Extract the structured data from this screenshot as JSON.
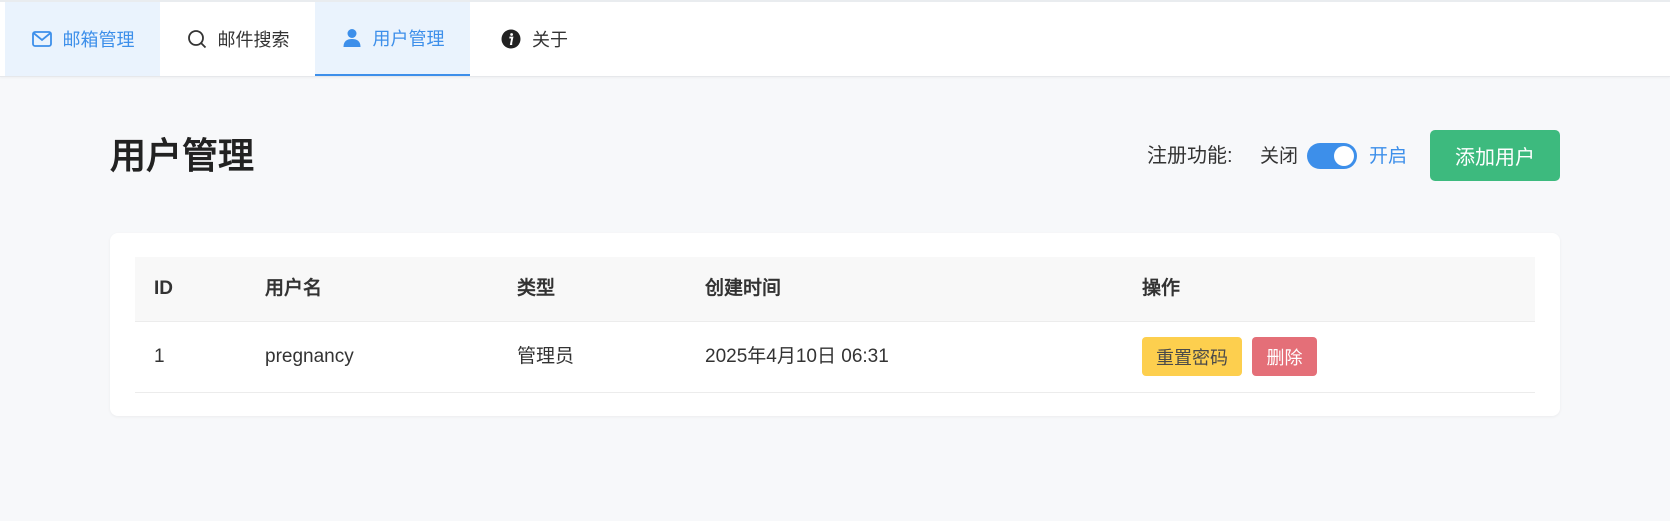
{
  "nav": {
    "tabs": [
      {
        "label": "邮箱管理",
        "icon": "mail-icon",
        "active": false
      },
      {
        "label": "邮件搜索",
        "icon": "search-icon",
        "active": false
      },
      {
        "label": "用户管理",
        "icon": "user-icon",
        "active": true
      },
      {
        "label": "关于",
        "icon": "info-icon",
        "active": false
      }
    ]
  },
  "header": {
    "title": "用户管理",
    "registration": {
      "label": "注册功能:",
      "off_label": "关闭",
      "on_label": "开启",
      "enabled": true
    },
    "add_button": "添加用户"
  },
  "table": {
    "columns": [
      "ID",
      "用户名",
      "类型",
      "创建时间",
      "操作"
    ],
    "rows": [
      {
        "id": "1",
        "username": "pregnancy",
        "type": "管理员",
        "created": "2025年4月10日 06:31",
        "actions": {
          "reset": "重置密码",
          "delete": "删除"
        }
      }
    ]
  },
  "colors": {
    "accent": "#3d8fea",
    "add_button": "#3dba7e",
    "reset_button": "#fdcf4e",
    "delete_button": "#e46f78"
  }
}
